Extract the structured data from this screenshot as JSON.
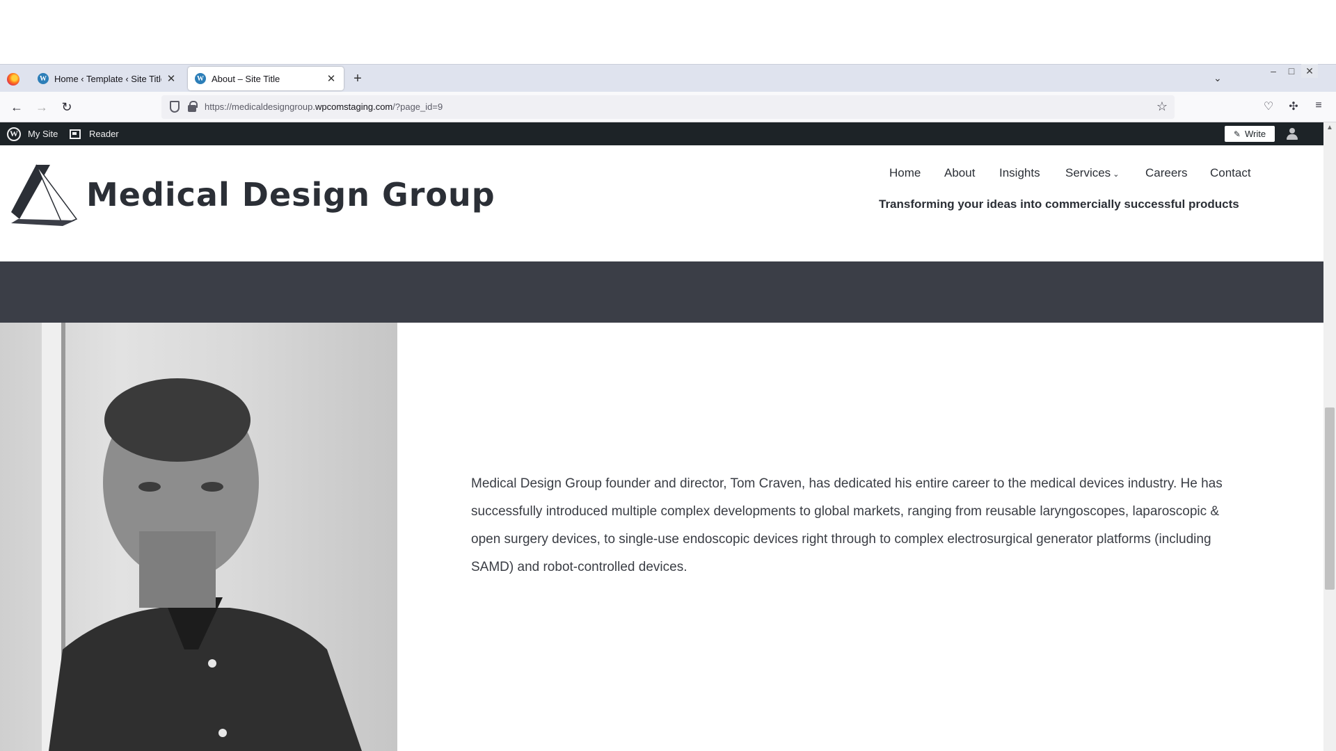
{
  "browser": {
    "tabs": [
      {
        "label": "Home ‹ Template ‹ Site Title ‹ E",
        "active": false
      },
      {
        "label": "About – Site Title",
        "active": true
      }
    ],
    "url_prefix": "https://medicaldesigngroup.",
    "url_host": "wpcomstaging.com",
    "url_suffix": "/?page_id=9",
    "icons": {
      "new_tab": "+",
      "close_tab": "✕",
      "back": "←",
      "forward": "→",
      "reload": "↻",
      "bookmark": "☆",
      "tab_list": "⌄",
      "menu": "≡"
    }
  },
  "admin_bar": {
    "my_site": "My Site",
    "reader": "Reader",
    "write": "Write"
  },
  "site": {
    "title": "Medical Design Group",
    "nav": [
      "Home",
      "About",
      "Insights",
      "Services",
      "Careers",
      "Contact"
    ],
    "services_chevron": "⌄",
    "tagline": "Transforming your ideas into commercially successful products"
  },
  "bio": "Medical Design Group founder and director, Tom Craven, has dedicated his entire career to the medical devices industry. He has successfully introduced multiple complex developments to global markets, ranging from reusable laryngoscopes, laparoscopic & open surgery devices, to single-use endoscopic devices right through to complex electrosurgical generator platforms (including SAMD) and robot-controlled devices.",
  "colors": {
    "admin_bar": "#1d2327",
    "dark_band": "#3b3e47",
    "text_dark": "#2b2f36",
    "wp_blue": "#2c7eb8"
  }
}
